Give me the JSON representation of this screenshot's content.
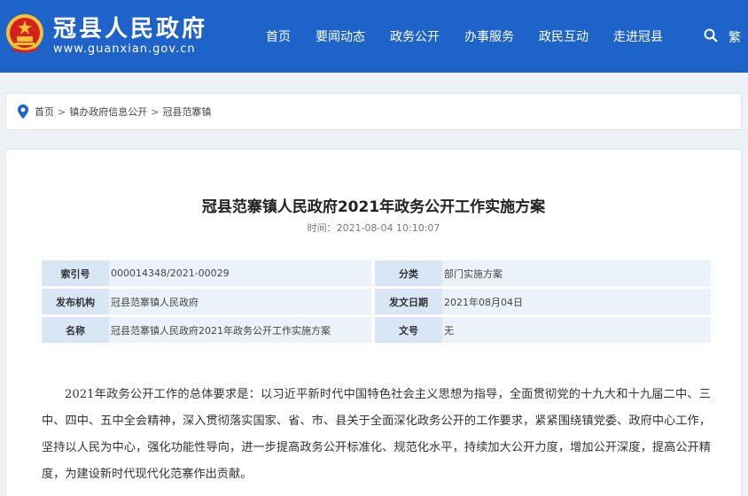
{
  "header": {
    "site_title": "冠县人民政府",
    "site_url": "www.guanxian.gov.cn",
    "nav": [
      "首页",
      "要闻动态",
      "政务公开",
      "办事服务",
      "政民互动",
      "走进冠县"
    ],
    "trad_label": "繁"
  },
  "breadcrumb": {
    "items": [
      "首页",
      "镇办政府信息公开",
      "冠县范寨镇"
    ],
    "separator": ">"
  },
  "article": {
    "title": "冠县范寨镇人民政府2021年政务公开工作实施方案",
    "time_label": "时间：",
    "time_value": "2021-08-04 10:10:07",
    "meta": {
      "index_label": "索引号",
      "index_value": "000014348/2021-00029",
      "category_label": "分类",
      "category_value": "部门实施方案",
      "publisher_label": "发布机构",
      "publisher_value": "冠县范寨镇人民政府",
      "date_label": "发文日期",
      "date_value": "2021年08月04日",
      "name_label": "名称",
      "name_value": "冠县范寨镇人民政府2021年政务公开工作实施方案",
      "doc_no_label": "文号",
      "doc_no_value": "无"
    },
    "body": "2021年政务公开工作的总体要求是：以习近平新时代中国特色社会主义思想为指导，全面贯彻党的十九大和十九届二中、三中、四中、五中全会精神，深入贯彻落实国家、省、市、县关于全面深化政务公开的工作要求，紧紧围绕镇党委、政府中心工作，坚持以人民为中心，强化功能性导向，进一步提高政务公开标准化、规范化水平，持续加大公开力度，增加公开深度，提高公开精度，为建设新时代现代化范寨作出贡献。"
  },
  "colors": {
    "header_bg": "#1d63c9",
    "meta_key_bg": "#d8e6f5",
    "meta_val_bg": "#ecf2f9"
  }
}
